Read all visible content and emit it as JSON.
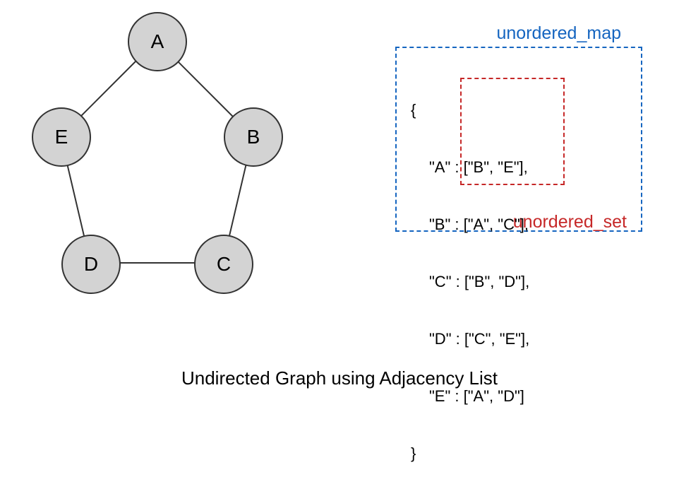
{
  "graph": {
    "nodes": {
      "A": "A",
      "B": "B",
      "C": "C",
      "D": "D",
      "E": "E"
    }
  },
  "labels": {
    "map": "unordered_map",
    "set": "unordered_set"
  },
  "adjacency": {
    "open": "{",
    "close": "}",
    "entries": {
      "A": "\"A\" : [\"B\", \"E\"],",
      "B": "\"B\" : [\"A\", \"C\"],",
      "C": "\"C\" : [\"B\", \"D\"],",
      "D": "\"D\" : [\"C\", \"E\"],",
      "E": "\"E\" : [\"A\", \"D\"]"
    }
  },
  "caption": "Undirected Graph using Adjacency List",
  "chart_data": {
    "type": "graph",
    "directed": false,
    "representation": "adjacency_list",
    "nodes": [
      "A",
      "B",
      "C",
      "D",
      "E"
    ],
    "edges": [
      [
        "A",
        "B"
      ],
      [
        "B",
        "C"
      ],
      [
        "C",
        "D"
      ],
      [
        "D",
        "E"
      ],
      [
        "E",
        "A"
      ]
    ],
    "adjacency_list": {
      "A": [
        "B",
        "E"
      ],
      "B": [
        "A",
        "C"
      ],
      "C": [
        "B",
        "D"
      ],
      "D": [
        "C",
        "E"
      ],
      "E": [
        "A",
        "D"
      ]
    },
    "container_types": {
      "outer": "unordered_map",
      "inner": "unordered_set"
    }
  }
}
